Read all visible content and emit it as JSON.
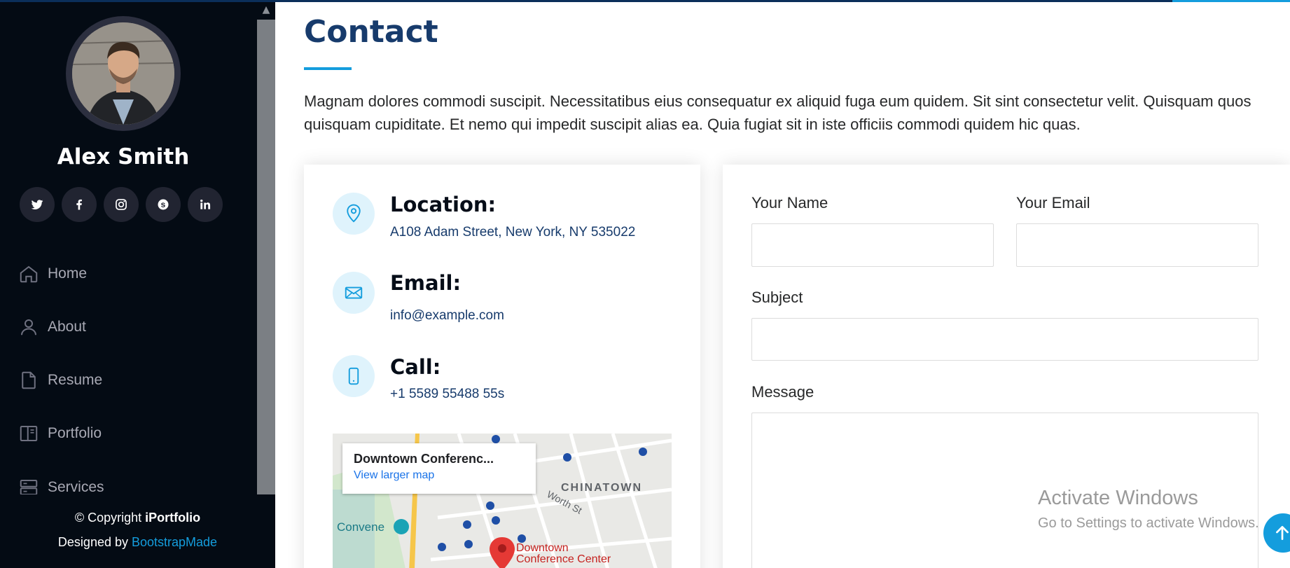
{
  "colors": {
    "accent": "#149ddd",
    "sidebar_bg": "#040b14",
    "heading": "#173b6c"
  },
  "sidebar": {
    "name": "Alex Smith",
    "social": [
      {
        "icon": "twitter-icon"
      },
      {
        "icon": "facebook-icon"
      },
      {
        "icon": "instagram-icon"
      },
      {
        "icon": "skype-icon"
      },
      {
        "icon": "linkedin-icon"
      }
    ],
    "nav": [
      {
        "label": "Home",
        "icon": "home-icon"
      },
      {
        "label": "About",
        "icon": "person-icon"
      },
      {
        "label": "Resume",
        "icon": "file-icon"
      },
      {
        "label": "Portfolio",
        "icon": "book-icon"
      },
      {
        "label": "Services",
        "icon": "server-icon"
      }
    ],
    "footer": {
      "copyright_prefix": "© Copyright ",
      "brand": "iPortfolio",
      "designed_by": "Designed by ",
      "designer": "BootstrapMade"
    }
  },
  "contact": {
    "title": "Contact",
    "intro": "Magnam dolores commodi suscipit. Necessitatibus eius consequatur ex aliquid fuga eum quidem. Sit sint consectetur velit. Quisquam quos quisquam cupiditate. Et nemo qui impedit suscipit alias ea. Quia fugiat sit in iste officiis commodi quidem hic quas.",
    "location": {
      "title": "Location:",
      "text": "A108 Adam Street, New York, NY 535022",
      "icon": "map-pin-icon"
    },
    "email": {
      "title": "Email:",
      "text": "info@example.com",
      "icon": "envelope-icon"
    },
    "call": {
      "title": "Call:",
      "text": "+1 5589 55488 55s",
      "icon": "phone-icon"
    },
    "map": {
      "card_title": "Downtown Conferenc...",
      "card_link": "View larger map",
      "labels": {
        "chinatown": "CHINATOWN",
        "worth": "Worth St",
        "convene": "Convene",
        "pin_line1": "Downtown",
        "pin_line2": "Conference Center"
      }
    }
  },
  "form": {
    "name_label": "Your Name",
    "email_label": "Your Email",
    "subject_label": "Subject",
    "message_label": "Message"
  },
  "watermark": {
    "line1": "Activate Windows",
    "line2": "Go to Settings to activate Windows."
  }
}
